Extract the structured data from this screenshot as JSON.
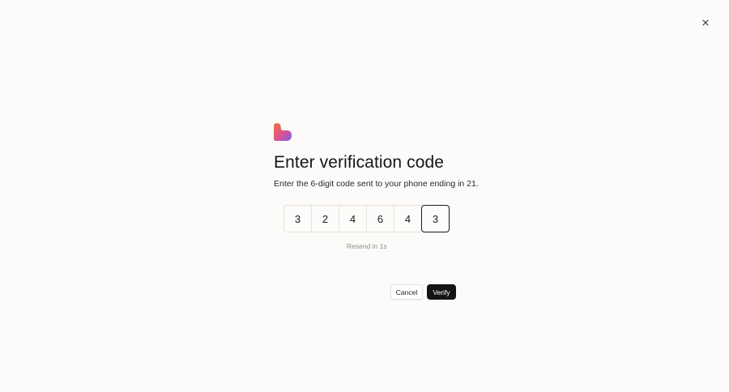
{
  "dialog": {
    "title": "Enter verification code",
    "subtitle": "Enter the 6-digit code sent to your phone ending in 21.",
    "code_digits": [
      "3",
      "2",
      "4",
      "6",
      "4",
      "3"
    ],
    "resend_text": "Resend in 1s",
    "cancel_label": "Cancel",
    "verify_label": "Verify"
  },
  "icons": {
    "close": "close-icon",
    "logo": "heart-logo"
  },
  "colors": {
    "background": "#fcfbf9",
    "primary_button": "#141414",
    "logo_top": "#f0713d",
    "logo_bottom": "#7a5cf0"
  }
}
